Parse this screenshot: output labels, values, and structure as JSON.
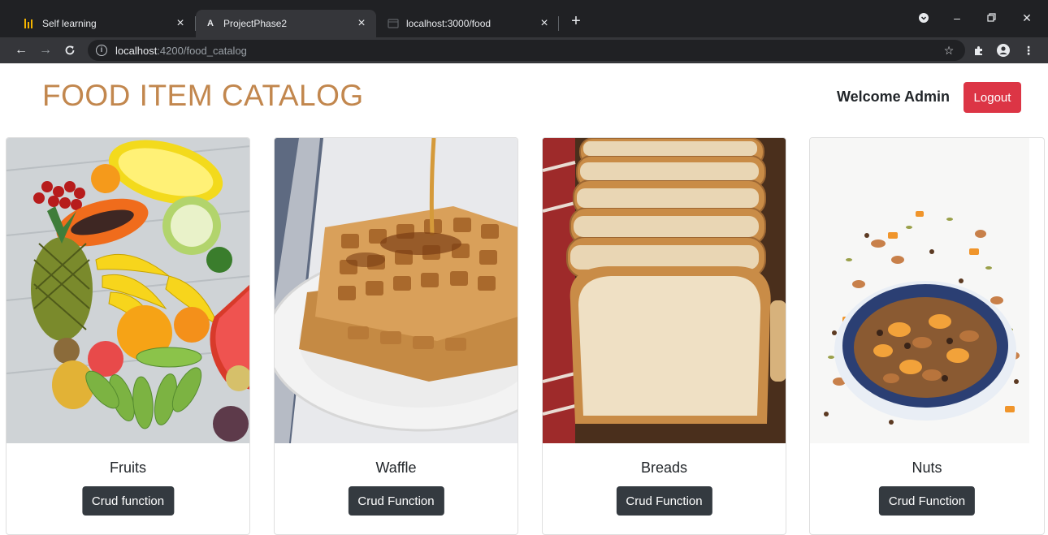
{
  "browser": {
    "tabs": [
      {
        "title": "Self learning",
        "favicon": "self-learning-icon"
      },
      {
        "title": "ProjectPhase2",
        "favicon": "angular-icon",
        "favicon_glyph": "A",
        "active": true
      },
      {
        "title": "localhost:3000/food",
        "favicon": "globe-icon"
      }
    ],
    "url_host": "localhost",
    "url_path": ":4200/food_catalog"
  },
  "header": {
    "title": "FOOD ITEM CATALOG",
    "welcome": "Welcome Admin",
    "logout_label": "Logout"
  },
  "colors": {
    "title": "#c2874e",
    "logout": "#dc3545",
    "crud_button": "#343a40"
  },
  "cards": [
    {
      "name": "Fruits",
      "button": "Crud function"
    },
    {
      "name": "Waffle",
      "button": "Crud Function"
    },
    {
      "name": "Breads",
      "button": "Crud Function"
    },
    {
      "name": "Nuts",
      "button": "Crud Function"
    }
  ]
}
